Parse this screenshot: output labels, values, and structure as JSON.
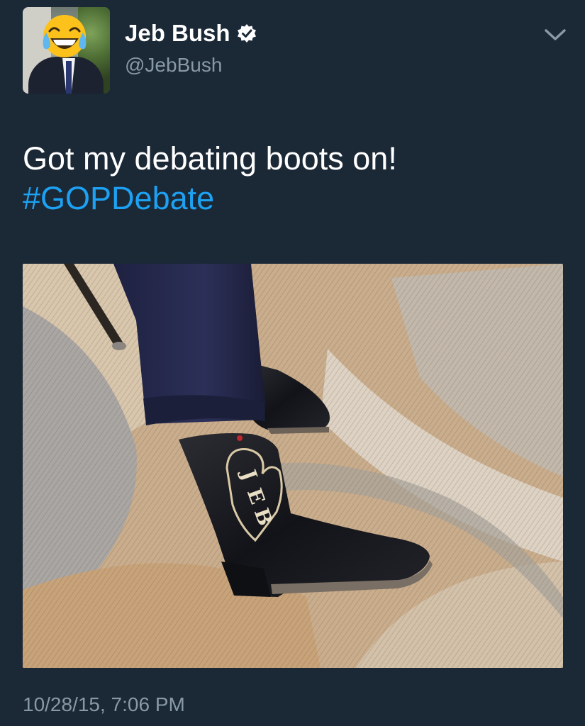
{
  "author": {
    "name": "Jeb Bush",
    "handle": "@JebBush",
    "verified": true,
    "avatar_icon": "face-with-tears-of-joy-emoji",
    "verified_icon": "verified-badge-icon"
  },
  "tweet": {
    "text": "Got my debating boots on!",
    "hashtag": "#GOPDebate",
    "boot_lettering": "JEB",
    "timestamp": "10/28/15, 7:06 PM"
  },
  "menu": {
    "icon": "chevron-down-icon"
  },
  "colors": {
    "background": "#1b2836",
    "text": "#ffffff",
    "secondary_text": "#8899a6",
    "link": "#1da1f2"
  }
}
